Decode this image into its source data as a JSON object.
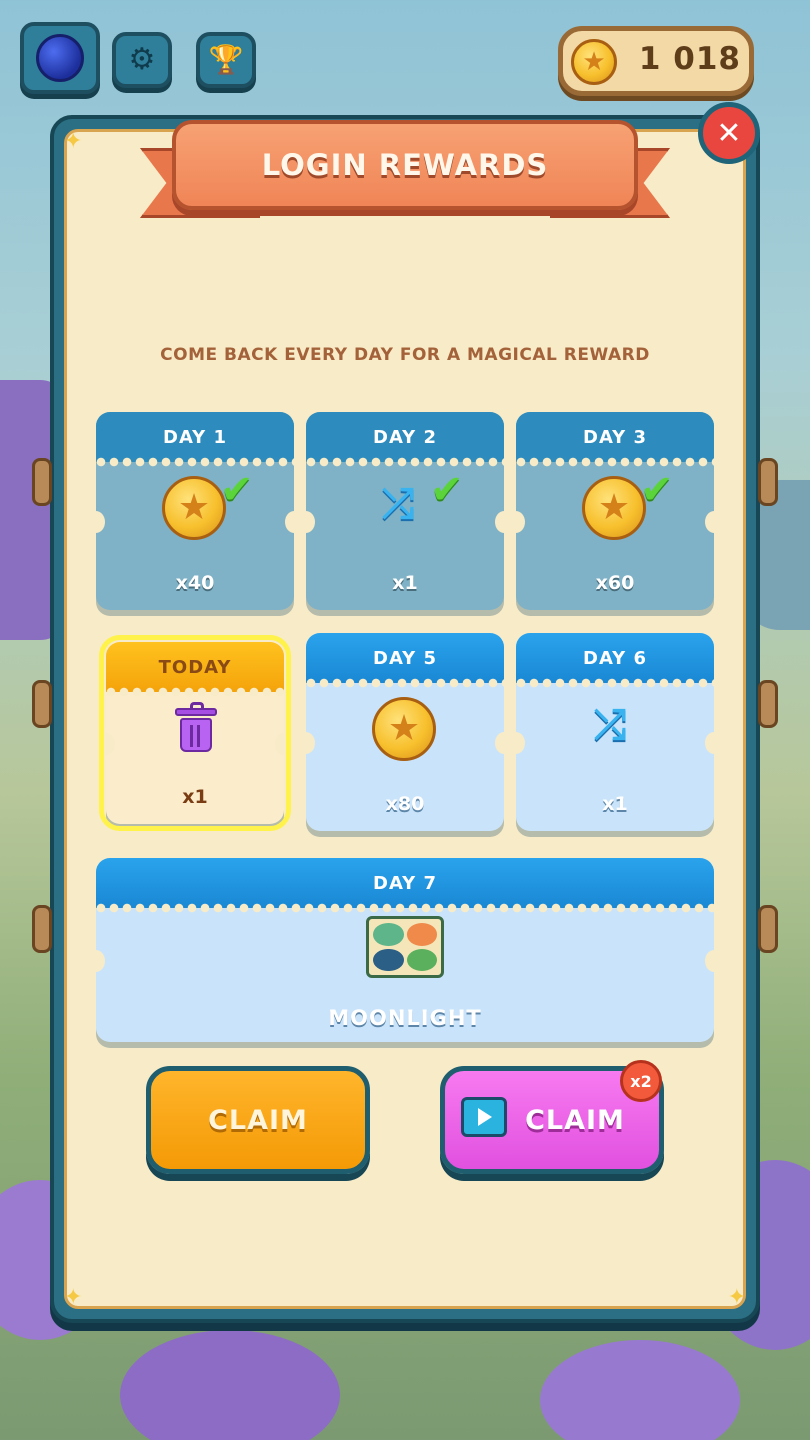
{
  "header": {
    "coins": "1 018"
  },
  "panel": {
    "title": "LOGIN REWARDS",
    "subtitle": "COME BACK EVERY DAY FOR A MAGICAL REWARD"
  },
  "days": [
    {
      "label": "DAY 1",
      "reward": "coin",
      "quantity": "x40",
      "state": "claimed"
    },
    {
      "label": "DAY 2",
      "reward": "shuffle-icon",
      "quantity": "x1",
      "state": "claimed"
    },
    {
      "label": "DAY 3",
      "reward": "coin",
      "quantity": "x60",
      "state": "claimed"
    },
    {
      "label": "TODAY",
      "reward": "trash-icon",
      "quantity": "x1",
      "state": "today"
    },
    {
      "label": "DAY 5",
      "reward": "coin",
      "quantity": "x80",
      "state": "locked"
    },
    {
      "label": "DAY 6",
      "reward": "shuffle-icon",
      "quantity": "x1",
      "state": "locked"
    },
    {
      "label": "DAY 7",
      "reward": "sticker-book-icon",
      "quantity": "MOONLIGHT",
      "state": "locked"
    }
  ],
  "buttons": {
    "claim_label": "CLAIM",
    "claim_ad_label": "CLAIM",
    "ad_multiplier": "x2"
  },
  "colors": {
    "panel_frame": "#2a6f83",
    "panel_bg": "#f8ebc7",
    "ribbon": "#f08557",
    "claimed_header": "#2d8cbd",
    "future_header": "#1a88d4",
    "today_header": "#f4a30a",
    "claim_button": "#f49a06",
    "ad_button": "#e151df"
  }
}
